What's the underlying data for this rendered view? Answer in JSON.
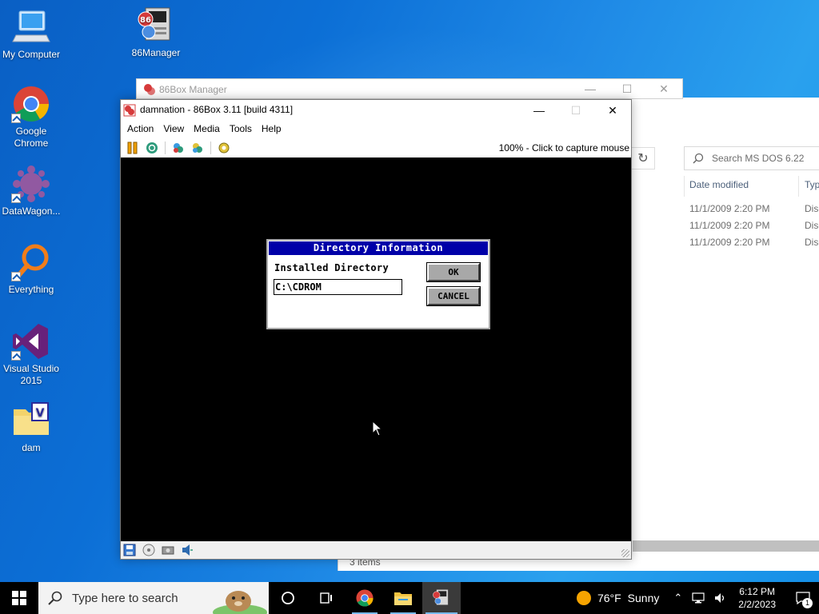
{
  "desktop": {
    "icons": [
      {
        "label": "My Computer"
      },
      {
        "label": "86Manager"
      },
      {
        "label": "Google Chrome"
      },
      {
        "label": "DataWagon..."
      },
      {
        "label": "Everything"
      },
      {
        "label": "Visual Studio 2015"
      },
      {
        "label": "dam"
      }
    ]
  },
  "explorer": {
    "search_placeholder": "Search MS DOS 6.22",
    "columns": {
      "date": "Date modified",
      "type": "Typ"
    },
    "rows": [
      {
        "date": "11/1/2009 2:20 PM",
        "type": "Disc"
      },
      {
        "date": "11/1/2009 2:20 PM",
        "type": "Disc"
      },
      {
        "date": "11/1/2009 2:20 PM",
        "type": "Disc"
      }
    ],
    "status": "3 items"
  },
  "manager": {
    "title": "86Box Manager"
  },
  "box86": {
    "title": "damnation - 86Box 3.11 [build 4311]",
    "menu": {
      "action": "Action",
      "view": "View",
      "media": "Media",
      "tools": "Tools",
      "help": "Help"
    },
    "status_right": "100% - Click to capture mouse"
  },
  "dos_dialog": {
    "title": "Directory Information",
    "label": "Installed Directory",
    "value": "C:\\CDROM",
    "ok": "OK",
    "cancel": "CANCEL"
  },
  "taskbar": {
    "search_placeholder": "Type here to search",
    "weather": {
      "temp": "76°F",
      "condition": "Sunny"
    },
    "time": "6:12 PM",
    "date": "2/2/2023",
    "notification_count": "1"
  },
  "colors": {
    "dos_title_bg": "#0000a8",
    "desktop_blue": "#0c6fd6",
    "accent": "#76b9ed"
  }
}
